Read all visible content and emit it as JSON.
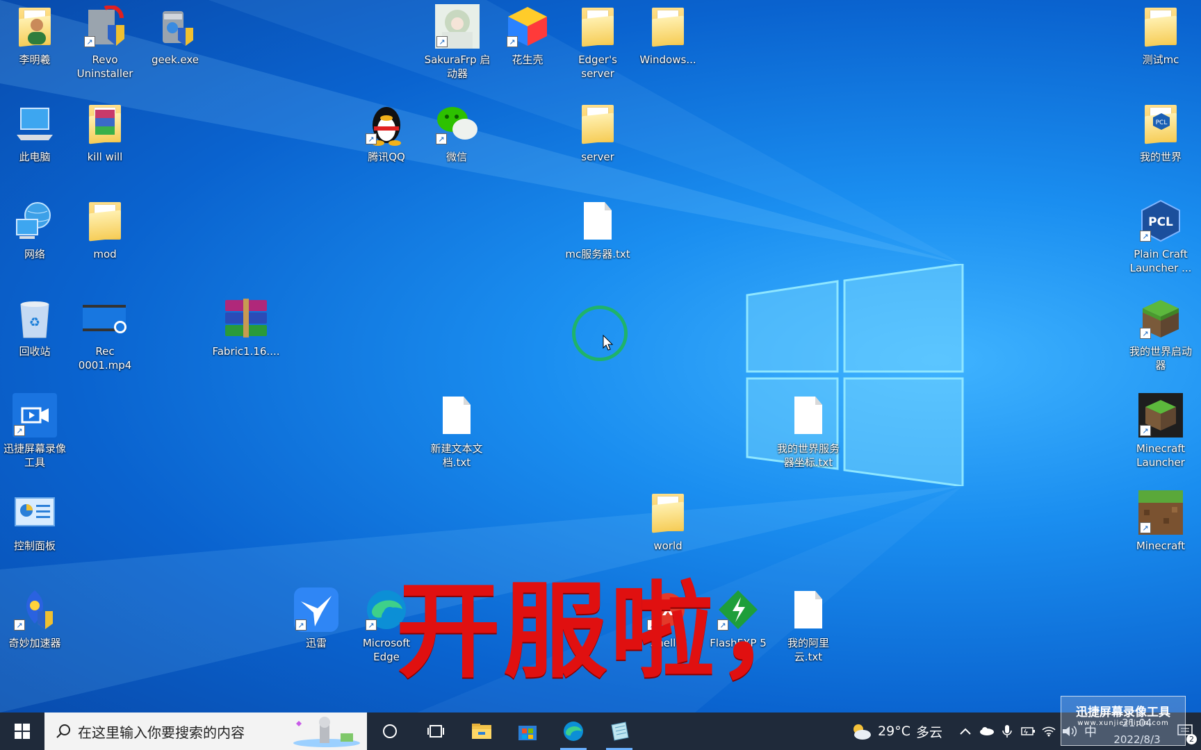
{
  "desktop": {
    "icons": [
      {
        "label": "李明羲",
        "icon": "user-folder-icon"
      },
      {
        "label": "Revo Uninstaller",
        "icon": "revo-uninstaller-icon"
      },
      {
        "label": "geek.exe",
        "icon": "geek-uninstaller-icon"
      },
      {
        "label": "SakuraFrp 启动器",
        "icon": "sakurafrp-icon"
      },
      {
        "label": "花生壳",
        "icon": "peanut-shell-icon"
      },
      {
        "label": "Edger's server",
        "icon": "folder-icon"
      },
      {
        "label": "Windows...",
        "icon": "folder-icon"
      },
      {
        "label": "测试mc",
        "icon": "folder-icon"
      },
      {
        "label": "此电脑",
        "icon": "this-pc-icon"
      },
      {
        "label": "kill will",
        "icon": "winrar-folder-icon"
      },
      {
        "label": "腾讯QQ",
        "icon": "qq-penguin-icon"
      },
      {
        "label": "微信",
        "icon": "wechat-icon"
      },
      {
        "label": "server",
        "icon": "folder-icon"
      },
      {
        "label": "我的世界",
        "icon": "pcl-folder-icon"
      },
      {
        "label": "网络",
        "icon": "network-globe-icon"
      },
      {
        "label": "mod",
        "icon": "folder-icon"
      },
      {
        "label": "mc服务器.txt",
        "icon": "text-file-icon"
      },
      {
        "label": "Plain Craft Launcher ...",
        "icon": "pcl-launcher-icon"
      },
      {
        "label": "回收站",
        "icon": "recycle-bin-icon"
      },
      {
        "label": "Rec 0001.mp4",
        "icon": "video-file-icon"
      },
      {
        "label": "Fabric1.16....",
        "icon": "winrar-archive-icon"
      },
      {
        "label": "我的世界启动器",
        "icon": "minecraft-grass-block-icon"
      },
      {
        "label": "迅捷屏幕录像工具",
        "icon": "screen-recorder-icon"
      },
      {
        "label": "新建文本文档.txt",
        "icon": "text-file-icon"
      },
      {
        "label": "我的世界服务器坐标.txt",
        "icon": "text-file-icon"
      },
      {
        "label": "Minecraft Launcher",
        "icon": "minecraft-launcher-icon"
      },
      {
        "label": "控制面板",
        "icon": "control-panel-icon"
      },
      {
        "label": "world",
        "icon": "folder-icon"
      },
      {
        "label": "Minecraft",
        "icon": "minecraft-dirt-icon"
      },
      {
        "label": "奇妙加速器",
        "icon": "qimiao-accelerator-icon"
      },
      {
        "label": "迅雷",
        "icon": "xunlei-bird-icon"
      },
      {
        "label": "Microsoft Edge",
        "icon": "edge-icon"
      },
      {
        "label": "Shell T",
        "icon": "xshell-icon"
      },
      {
        "label": "FlashFXP 5",
        "icon": "flashfxp-icon"
      },
      {
        "label": "我的阿里云.txt",
        "icon": "text-file-icon"
      }
    ],
    "overlay_caption": "开服啦，",
    "watermark": {
      "title": "迅捷屏幕录像工具",
      "url": "www.xunjieshipin.com"
    }
  },
  "taskbar": {
    "search_placeholder": "在这里输入你要搜索的内容",
    "pinned": [
      "cortana-circle-icon",
      "task-view-icon",
      "file-explorer-icon",
      "microsoft-store-icon",
      "edge-icon",
      "notepad-icon"
    ],
    "weather": {
      "temp": "29°C",
      "condition": "多云"
    },
    "ime": "中",
    "time": "21:04",
    "date": "2022/8/3",
    "notification_count": "2",
    "accent": "#1f2a3a"
  }
}
